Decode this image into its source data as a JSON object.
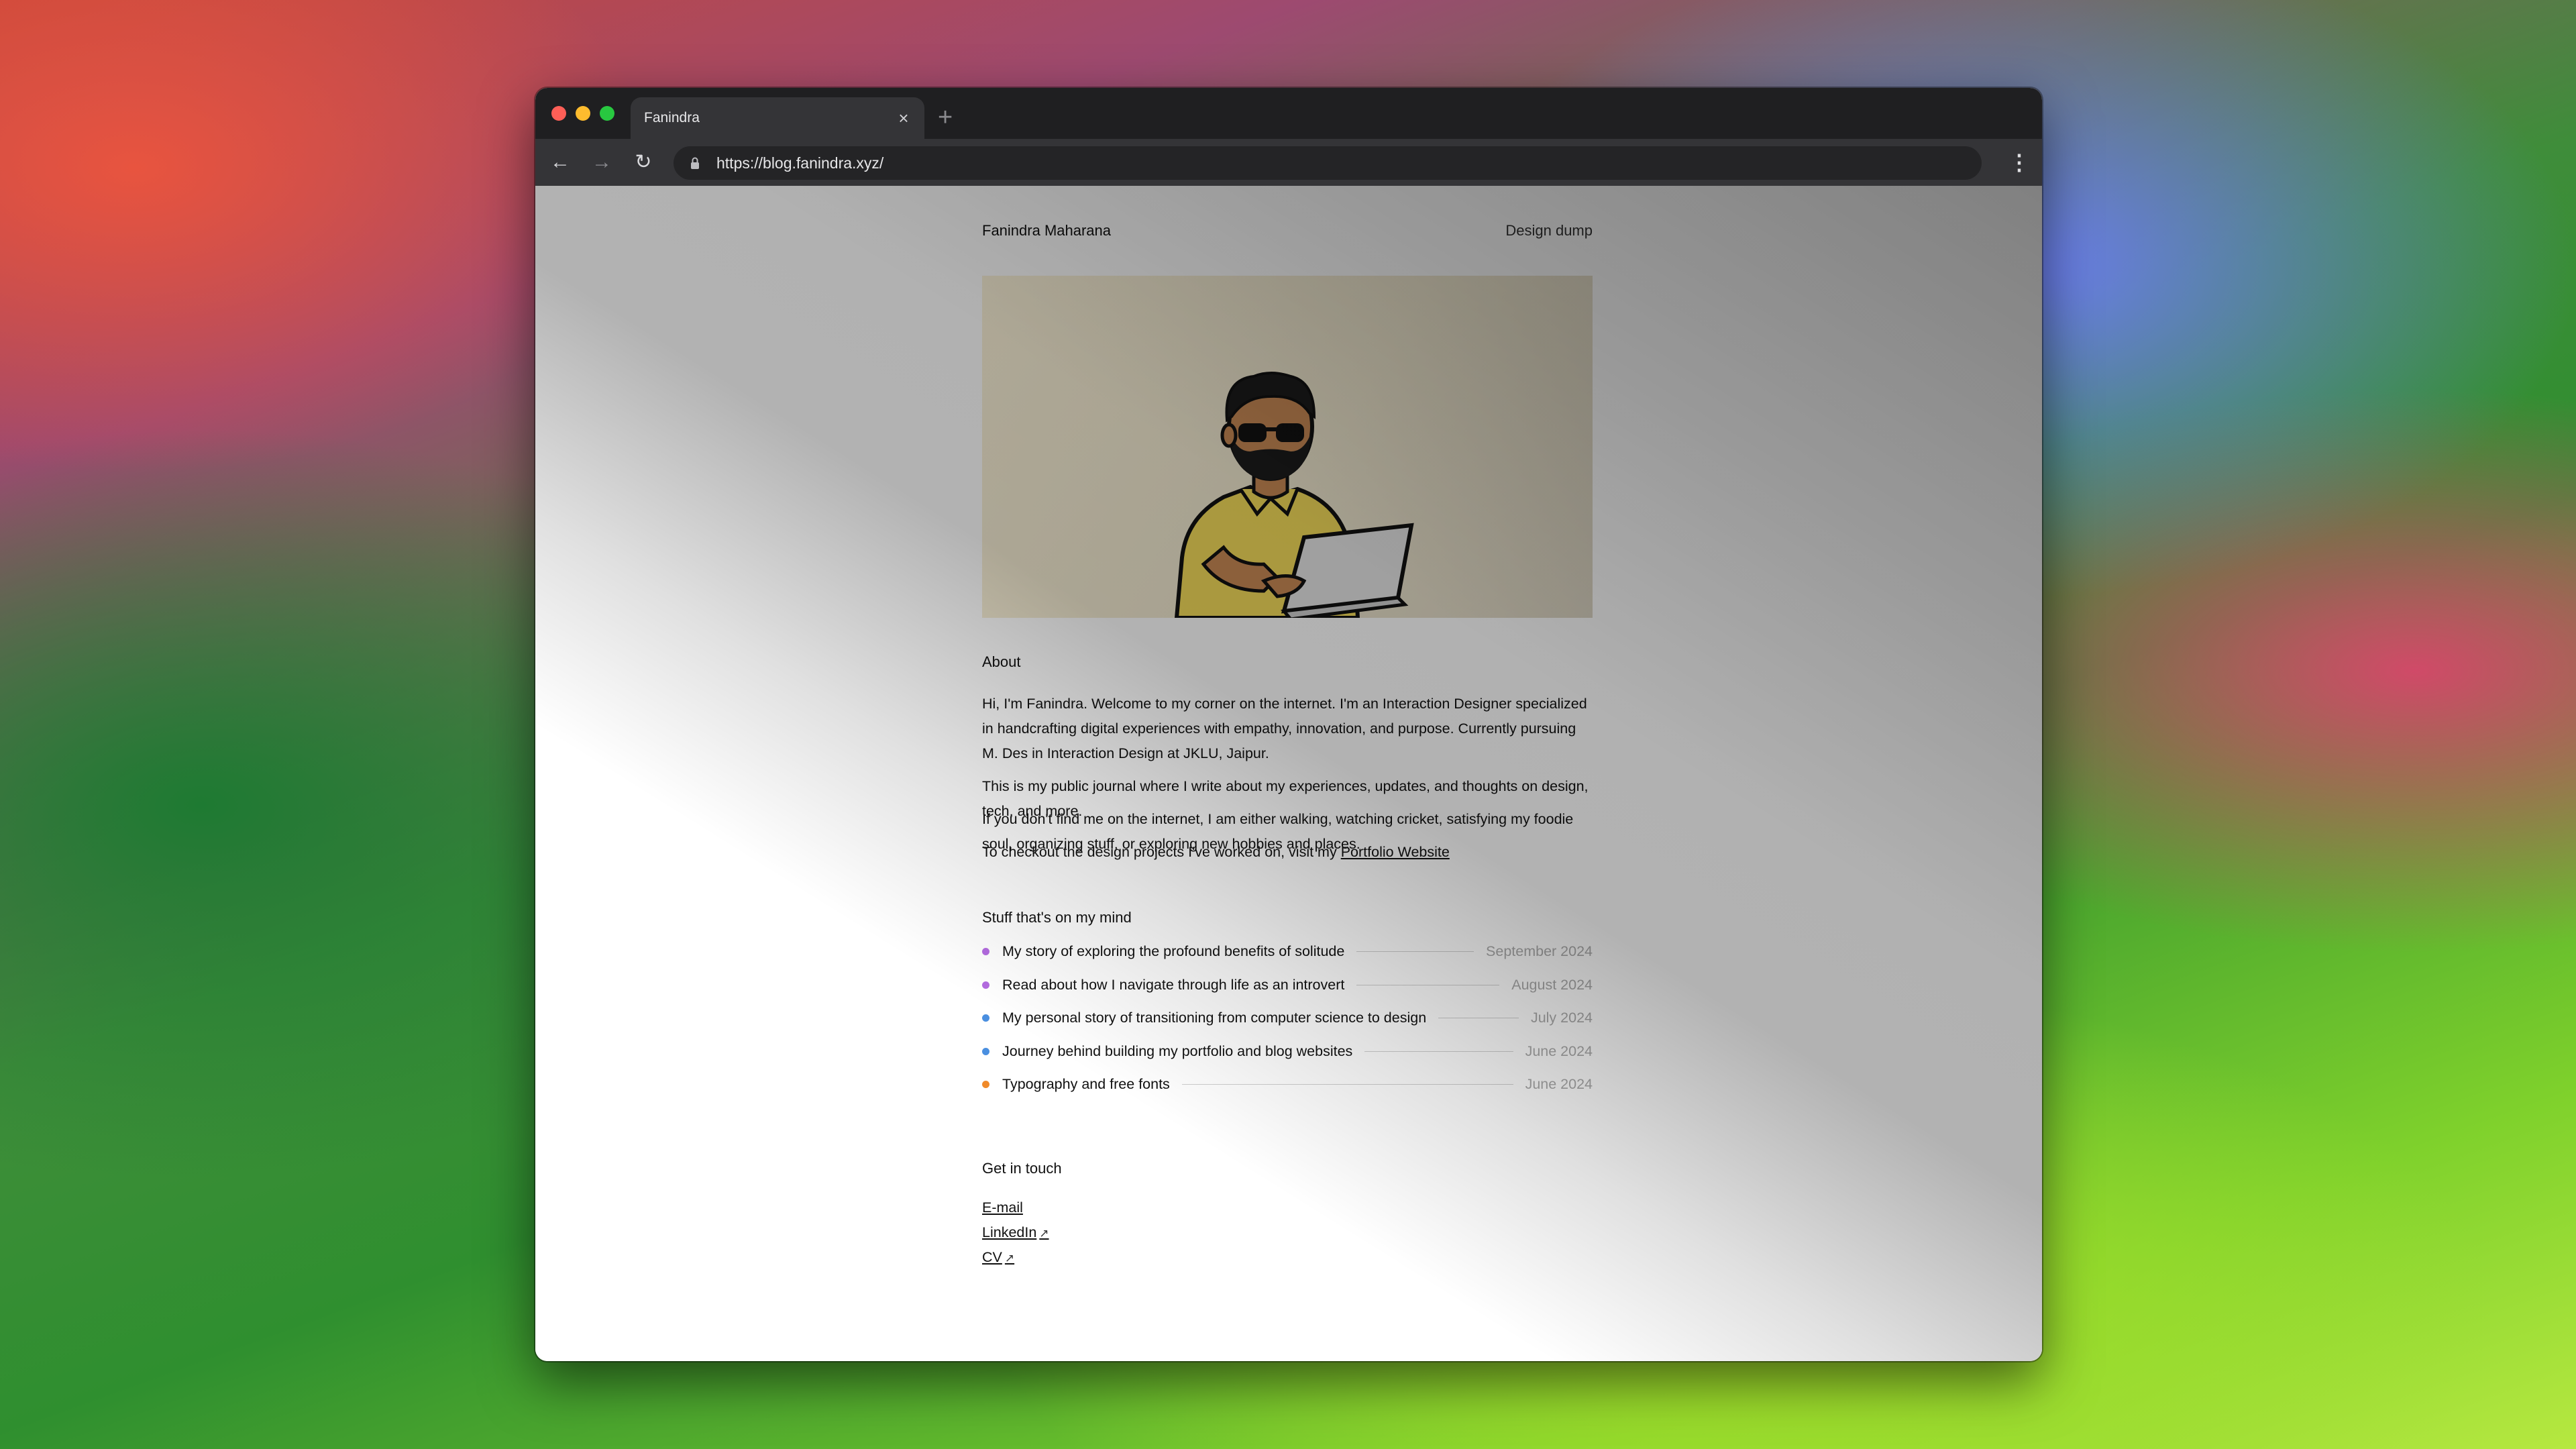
{
  "browser": {
    "tab_title": "Fanindra",
    "tab_close": "×",
    "new_tab": "+",
    "url": "https://blog.fanindra.xyz/",
    "nav": {
      "back": "←",
      "forward": "→",
      "reload": "↻",
      "menu": "⋮"
    }
  },
  "site": {
    "name": "Fanindra Maharana",
    "nav_link": "Design dump"
  },
  "about": {
    "title": "About",
    "paragraphs": [
      "Hi, I'm Fanindra. Welcome to my corner on the internet. I'm an Interaction Designer specialized in handcrafting digital experiences with empathy, innovation, and purpose. Currently pursuing M. Des in Interaction Design at JKLU, Jaipur.",
      "This is my public journal where I write about my experiences, updates, and thoughts on design, tech, and more.",
      "If you don't find me on the internet, I am either walking, watching cricket, satisfying my foodie soul, organizing stuff, or exploring new hobbies and places."
    ],
    "portfolio_prefix": "To checkout the design projects I've worked on, visit my",
    "portfolio_link": "Portfolio Website"
  },
  "posts_section": {
    "title": "Stuff that's on my mind",
    "posts": [
      {
        "title": "My story of exploring the profound benefits of solitude",
        "date": "September 2024",
        "color": "#b36be0"
      },
      {
        "title": "Read about how I navigate through life as an introvert",
        "date": "August 2024",
        "color": "#b36be0"
      },
      {
        "title": "My personal story of transitioning from computer science to design",
        "date": "July 2024",
        "color": "#4a8fe0"
      },
      {
        "title": "Journey behind building my portfolio and blog websites",
        "date": "June 2024",
        "color": "#4a8fe0"
      },
      {
        "title": "Typography and free fonts",
        "date": "June 2024",
        "color": "#f08a2a"
      }
    ]
  },
  "contact": {
    "title": "Get in touch",
    "links": [
      {
        "label": "E-mail",
        "external": ""
      },
      {
        "label": "LinkedIn",
        "external": "↗"
      },
      {
        "label": "CV",
        "external": "↗"
      }
    ]
  }
}
